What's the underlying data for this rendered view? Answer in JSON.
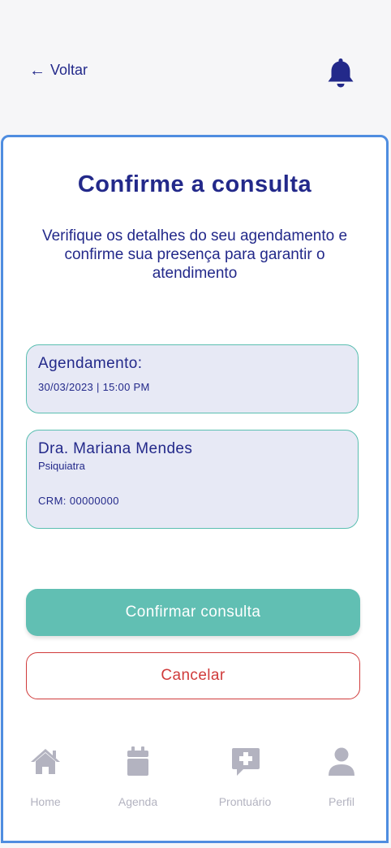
{
  "header": {
    "back_label": "Voltar",
    "back_icon": "arrow-left-icon",
    "bell_icon": "bell-icon"
  },
  "main": {
    "title": "Confirme a consulta",
    "subtitle": "Verifique os detalhes do seu agendamento e confirme sua presença para garantir o atendimento"
  },
  "appointment": {
    "heading": "Agendamento:",
    "datetime": "30/03/2023 | 15:00 PM"
  },
  "doctor": {
    "name": "Dra. Mariana Mendes",
    "specialty": "Psiquiatra",
    "crm": "CRM: 00000000"
  },
  "actions": {
    "confirm_label": "Confirmar consulta",
    "cancel_label": "Cancelar"
  },
  "nav": {
    "items": [
      {
        "label": "Home",
        "icon": "home-icon"
      },
      {
        "label": "Agenda",
        "icon": "calendar-icon"
      },
      {
        "label": "Prontuário",
        "icon": "medical-record-icon"
      },
      {
        "label": "Perfil",
        "icon": "user-icon"
      }
    ]
  },
  "colors": {
    "primary": "#23298a",
    "accent": "#61bfb3",
    "danger": "#d03b3b",
    "nav_inactive": "#b3b3c0",
    "border": "#4f8de0"
  }
}
